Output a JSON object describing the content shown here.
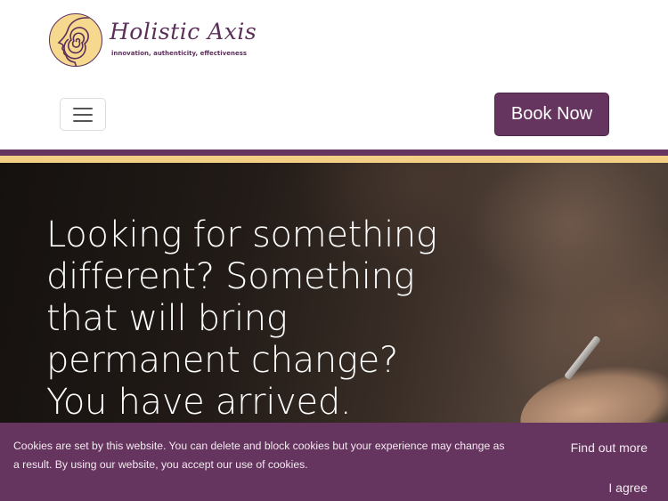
{
  "brand": {
    "name": "Holistic Axis",
    "tagline": "innovation, authenticity, effectiveness",
    "logo_icon": "spiral-head-logo-icon",
    "colors": {
      "primary": "#65345f",
      "accent": "#f3cf85"
    }
  },
  "nav": {
    "menu_icon": "hamburger-menu-icon",
    "book_label": "Book Now"
  },
  "hero": {
    "heading": "Looking for something different? Something that will bring permanent change? You have arrived."
  },
  "cookie_notice": {
    "text": "Cookies are set by this website. You can delete and block cookies but your experience may change as a result. By using our website, you accept our use of cookies.",
    "find_out_more": "Find out more",
    "agree": "I agree"
  }
}
